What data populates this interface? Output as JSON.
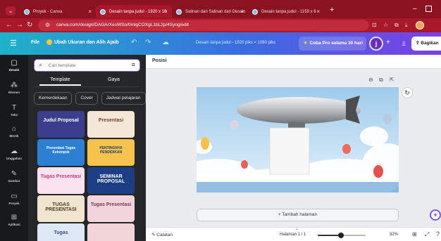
{
  "browser": {
    "tabs": [
      {
        "title": "Proyek - Canva",
        "active": false
      },
      {
        "title": "Desain tanpa judul - 1920 x 10",
        "active": true
      },
      {
        "title": "Salinan dari Salinan dari Desain",
        "active": false
      },
      {
        "title": "Desain tanpa judul - 1158 x 6",
        "active": false
      }
    ],
    "url": "canva.com/design/DAGArXesWSo/0mlgCOXgL1bL2p/4Syng/edit",
    "new_tab_glyph": "+",
    "min_glyph": "–"
  },
  "canva": {
    "file_label": "File",
    "resize_label": "Ubah Ukuran dan Alih Ajaib",
    "doc_title": "Desain tanpa judul - 1920 piks × 1080 piks",
    "pro_label": "Coba Pro selama 30 hari",
    "avatar_initial": "j",
    "share_label": "Bagikan"
  },
  "rail": [
    {
      "label": "Desain",
      "icon": "▢",
      "active": true
    },
    {
      "label": "Elemen",
      "icon": "⁂",
      "active": false
    },
    {
      "label": "Teks",
      "icon": "T",
      "active": false
    },
    {
      "label": "Merek",
      "icon": "⌂",
      "active": false
    },
    {
      "label": "Unggahan",
      "icon": "☁",
      "active": false
    },
    {
      "label": "Gambar",
      "icon": "✎",
      "active": false
    },
    {
      "label": "Proyek",
      "icon": "▭",
      "active": false
    },
    {
      "label": "Aplikasi",
      "icon": "⊞",
      "active": false
    }
  ],
  "panel": {
    "search_placeholder": "Cari template",
    "tabs": [
      "Template",
      "Gaya"
    ],
    "chips": [
      "Kemerdekaan",
      "Cover",
      "Jadwal pelajaran"
    ],
    "templates": [
      {
        "title": "Judul Proposal",
        "bg": "#3b3e8c",
        "fg": "#ffffff"
      },
      {
        "title": "Presentasi",
        "bg": "#f4e7d8",
        "fg": "#7a3b2e"
      },
      {
        "title": "Presentasi Tugas Kelompok",
        "bg": "#2c7fd1",
        "fg": "#ffffff"
      },
      {
        "title": "PENTINGNYA PENDIDIKAN",
        "bg": "#f6c44c",
        "fg": "#1d3a6b"
      },
      {
        "title": "Tugas Presentasi",
        "bg": "#fbe2ef",
        "fg": "#c23a7b"
      },
      {
        "title": "SEMINAR PROPOSAL",
        "bg": "#1b3f82",
        "fg": "#ffffff"
      },
      {
        "title": "TUGAS PRESENTASI",
        "bg": "#f1e5cf",
        "fg": "#4a3a22"
      },
      {
        "title": "Tugas Presentasi",
        "bg": "#f3d3dc",
        "fg": "#7b3c4e"
      },
      {
        "title": "Tugas",
        "bg": "#dfe8f7",
        "fg": "#3b4d8f"
      },
      {
        "title": "",
        "bg": "#f2d5d9",
        "fg": "#9b2a3c"
      }
    ]
  },
  "editor": {
    "toolbar_label": "Posisi",
    "add_page_label": "+ Tambah halaman",
    "notes_label": "Catatan",
    "page_indicator": "Halaman 1 / 1",
    "zoom_label": "32%",
    "zoom": 0.48
  },
  "colors": {
    "tab_bg": "#8b1220",
    "accent": "#7b3fe6"
  }
}
